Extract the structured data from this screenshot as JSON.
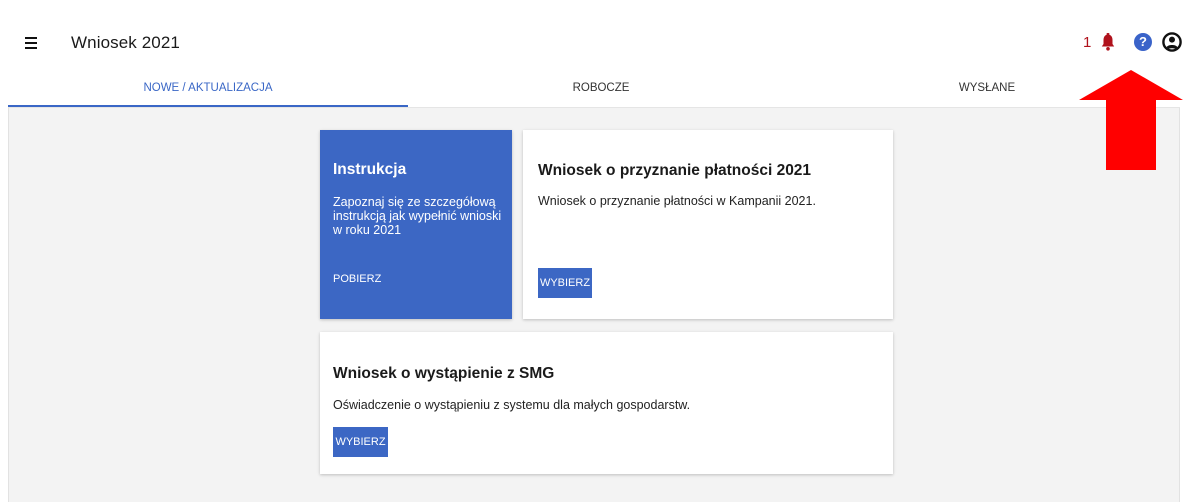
{
  "header": {
    "title": "Wniosek 2021",
    "notification_count": "1"
  },
  "icons": {
    "menu": "hamburger-menu-icon",
    "bell": "bell-icon",
    "help": "help-icon",
    "user": "user-account-icon",
    "annotation_arrow": "red-arrow-icon"
  },
  "colors": {
    "accent": "#3c67c4",
    "notification": "#b0121c",
    "arrow": "#ff0000"
  },
  "help_glyph": "?",
  "tabs": [
    {
      "label": "NOWE / AKTUALIZACJA",
      "active": true
    },
    {
      "label": "ROBOCZE",
      "active": false
    },
    {
      "label": "WYSŁANE",
      "active": false
    }
  ],
  "cards": {
    "instruction": {
      "title": "Instrukcja",
      "description": "Zapoznaj się ze szczegółową instrukcją jak wypełnić wnioski w roku 2021",
      "action": "POBIERZ"
    },
    "payment": {
      "title": "Wniosek o przyznanie płatności 2021",
      "description": "Wniosek o przyznanie płatności w Kampanii 2021.",
      "action": "WYBIERZ"
    },
    "smg": {
      "title": "Wniosek o wystąpienie z SMG",
      "description": "Oświadczenie o wystąpieniu z systemu dla małych gospodarstw.",
      "action": "WYBIERZ"
    }
  }
}
